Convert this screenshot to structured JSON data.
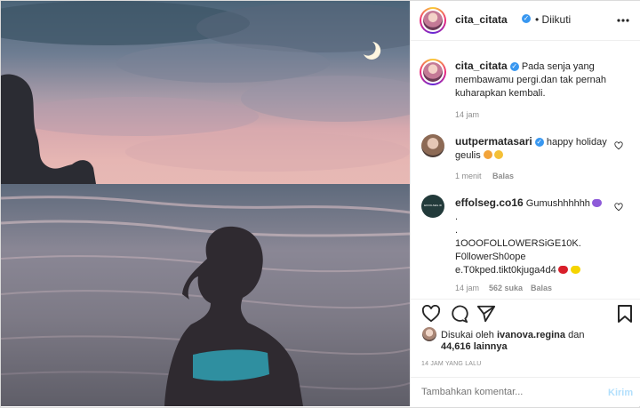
{
  "post": {
    "author": "cita_citata",
    "follow_status": "• Diikuti",
    "caption": "Pada senja yang membawamu pergi.dan tak pernah kuharapkan kembali.",
    "caption_time": "14 jam"
  },
  "comments": [
    {
      "username": "uutpermatasari",
      "text": "happy holiday geulis",
      "time": "1 menit",
      "reply": "Balas"
    },
    {
      "username": "effolseg.co16",
      "avatar_text": "EFFOLSEG.ID",
      "lines": [
        "Gumushhhhhh",
        ".",
        ".",
        "1OOOFOLLOWERSiGE10K.",
        "F0llowerSh0ope",
        "e.T0kped.tikt0kjuga4d4"
      ],
      "time": "14 jam",
      "likes": "562 suka",
      "reply": "Balas"
    }
  ],
  "likes": {
    "prefix": "Disukai oleh",
    "user": "ivanova.regina",
    "conj": "dan",
    "count": "44,616",
    "suffix": "lainnya"
  },
  "timestamp": "14 JAM YANG LALU",
  "comment_box": {
    "placeholder": "Tambahkan komentar...",
    "send": "Kirim"
  }
}
